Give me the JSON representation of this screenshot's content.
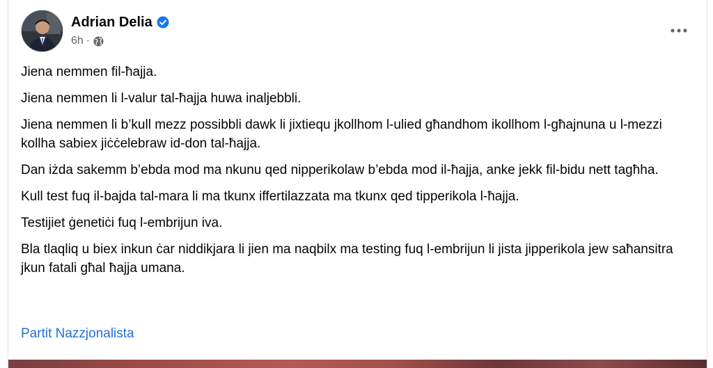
{
  "post": {
    "author": "Adrian Delia",
    "time": "6h",
    "separator": "·",
    "icons": {
      "verified": "verified-badge-icon",
      "audience": "globe-icon",
      "more": "more-options-icon"
    },
    "paragraphs": [
      "Jiena nemmen fil-ħajja.",
      "Jiena nemmen li l-valur tal-ħajja huwa inaljebbli.",
      "Jiena nemmen li b’kull mezz possibbli dawk li jixtiequ jkollhom l-ulied għandhom ikollhom l-għajnuna u l-mezzi kollha sabiex jiċċelebraw id-don tal-ħajja.",
      "Dan iżda sakemm b’ebda mod ma nkunu qed nipperikolaw b’ebda mod il-ħajja, anke jekk fil-bidu nett tagħha.",
      "Kull test fuq il-bajda tal-mara li ma tkunx iffertilazzata ma tkunx qed tipperikola l-ħajja.",
      "Testijiet ġenetiċi fuq l-embrijun iva.",
      "Bla tlaqliq u biex inkun ċar niddikjara li jien ma naqbilx ma testing fuq l-embrijun li jista jipperikola jew saħansitra jkun fatali għal ħajja umana."
    ],
    "page_link": "Partit Nazzjonalista"
  },
  "colors": {
    "text": "#050505",
    "secondary": "#65676b",
    "link": "#216fdb",
    "verified": "#1877f2"
  }
}
